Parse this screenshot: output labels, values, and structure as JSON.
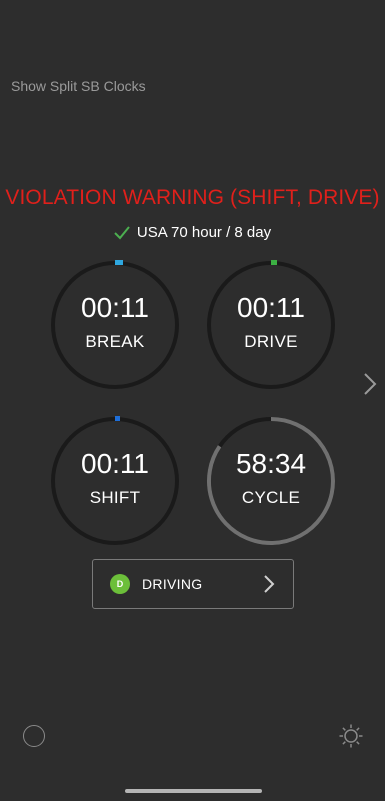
{
  "split_sb_label": "Show Split SB Clocks",
  "violation_warning": "VIOLATION WARNING (SHIFT, DRIVE)",
  "ruleset": "USA 70 hour / 8 day",
  "colors": {
    "warning": "#e0201b",
    "check": "#4caf50",
    "break_marker": "#2fa8e0",
    "drive_marker": "#3cb043",
    "shift_marker": "#1e6fd9",
    "cycle_arc": "#707070",
    "status_dot": "#6cbf3a"
  },
  "clocks": {
    "break": {
      "time": "00:11",
      "label": "BREAK"
    },
    "drive": {
      "time": "00:11",
      "label": "DRIVE"
    },
    "shift": {
      "time": "00:11",
      "label": "SHIFT"
    },
    "cycle": {
      "time": "58:34",
      "label": "CYCLE"
    }
  },
  "duty_status": {
    "badge": "D",
    "label": "DRIVING"
  },
  "icons": {
    "check": "check-icon",
    "next": "chevron-right-icon",
    "status_chevron": "chevron-right-icon",
    "left_button": "circle-icon",
    "brightness": "sun-icon"
  }
}
